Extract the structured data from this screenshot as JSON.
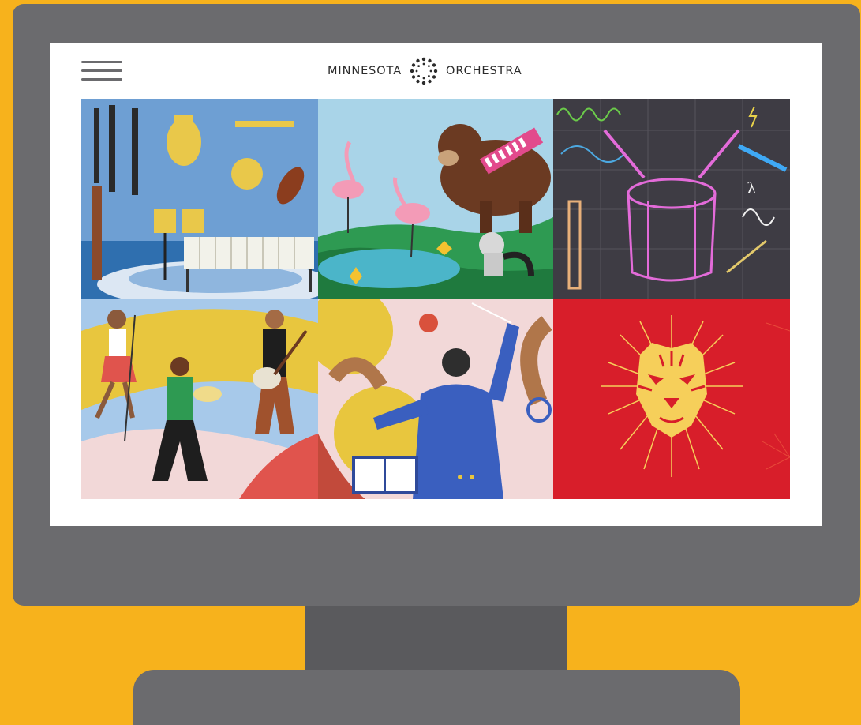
{
  "header": {
    "menu_icon": "hamburger-menu-icon",
    "logo_left": "MINNESOTA",
    "logo_right": "ORCHESTRA",
    "logo_icon": "orchestra-dots-logo-icon"
  },
  "tiles": [
    {
      "icon": "orchestra-instruments-illustration"
    },
    {
      "icon": "bear-flamingo-animals-illustration"
    },
    {
      "icon": "chalkboard-drum-science-illustration"
    },
    {
      "icon": "dancing-musicians-illustration"
    },
    {
      "icon": "conductor-illustration"
    },
    {
      "icon": "tiger-face-illustration"
    }
  ],
  "colors": {
    "background": "#F7B21C",
    "monitor": "#6B6B6E",
    "stand": "#5A5A5D",
    "screen": "#FFFFFF",
    "tiger_red": "#D81E2A",
    "sky_blue": "#6E9FD3"
  }
}
